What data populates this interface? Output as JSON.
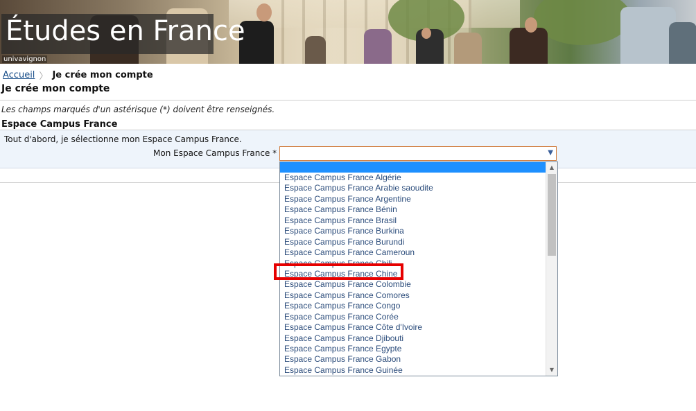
{
  "banner": {
    "title": "Études en France",
    "credit": "univavignon"
  },
  "breadcrumb": {
    "home": "Accueil",
    "current": "Je crée mon compte"
  },
  "page": {
    "title": "Je crée mon compte",
    "required_note": "Les champs marqués d'un astérisque (*) doivent être renseignés.",
    "section_title": "Espace Campus France",
    "intro": "Tout d'abord, je sélectionne mon Espace Campus France."
  },
  "form": {
    "field_label": "Mon Espace Campus France * :",
    "selected_value": "",
    "options": [
      "Espace Campus France Algérie",
      "Espace Campus France Arabie saoudite",
      "Espace Campus France Argentine",
      "Espace Campus France Bénin",
      "Espace Campus France Brasil",
      "Espace Campus France Burkina",
      "Espace Campus France Burundi",
      "Espace Campus France Cameroun",
      "Espace Campus France Chili",
      "Espace Campus France Chine",
      "Espace Campus France Colombie",
      "Espace Campus France Comores",
      "Espace Campus France Congo",
      "Espace Campus France Corée",
      "Espace Campus France Côte d'Ivoire",
      "Espace Campus France Djibouti",
      "Espace Campus France Egypte",
      "Espace Campus France Gabon",
      "Espace Campus France Guinée"
    ]
  },
  "colors": {
    "link": "#1a4f8a",
    "option_text": "#2a4b7a",
    "selected_blank": "#1e90ff",
    "highlight_box": "#e60000",
    "panel_bg": "#eef4fb"
  }
}
